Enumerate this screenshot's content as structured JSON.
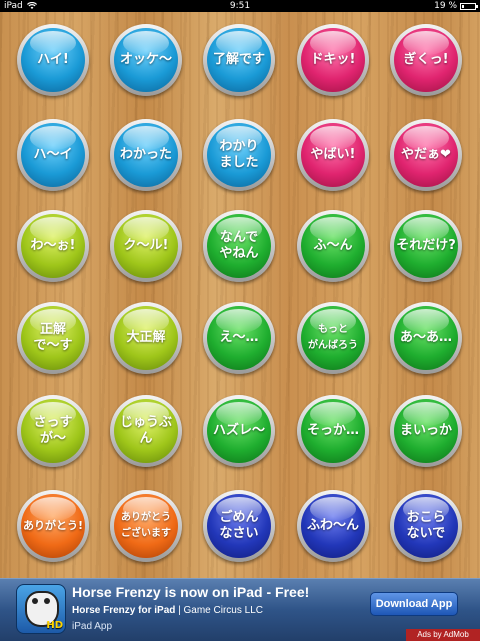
{
  "status_bar": {
    "device": "iPad",
    "time": "9:51",
    "battery": "19 %",
    "battery_level": 0.19
  },
  "colors": {
    "blue": "#1a9ad6",
    "pink": "#e0246f",
    "yellowgreen": "#9fc61a",
    "green": "#1fae2f",
    "orange": "#f06a16",
    "navy": "#2237b9"
  },
  "rows": [
    [
      {
        "label": "ハイ!",
        "color": "blue"
      },
      {
        "label": "オッケ〜",
        "color": "blue"
      },
      {
        "label": "了解です",
        "color": "blue"
      },
      {
        "label": "ドキッ!",
        "color": "pink"
      },
      {
        "label": "ぎくっ!",
        "color": "pink"
      }
    ],
    [
      {
        "label": "ハ〜イ",
        "color": "blue"
      },
      {
        "label": "わかった",
        "color": "blue"
      },
      {
        "label": "わかり\nました",
        "color": "blue"
      },
      {
        "label": "やばい!",
        "color": "pink"
      },
      {
        "label": "やだぁ❤",
        "color": "pink"
      }
    ],
    [
      {
        "label": "わ〜ぉ!",
        "color": "yellowgreen"
      },
      {
        "label": "ク〜ル!",
        "color": "yellowgreen"
      },
      {
        "label": "なんで\nやねん",
        "color": "green"
      },
      {
        "label": "ふ〜ん",
        "color": "green"
      },
      {
        "label": "それだけ?",
        "color": "green"
      }
    ],
    [
      {
        "label": "正解\nで〜す",
        "color": "yellowgreen"
      },
      {
        "label": "大正解",
        "color": "yellowgreen"
      },
      {
        "label": "え〜…",
        "color": "green"
      },
      {
        "label": "もっと\nがんばろう",
        "color": "green"
      },
      {
        "label": "あ〜あ…",
        "color": "green"
      }
    ],
    [
      {
        "label": "さっすが〜",
        "color": "yellowgreen"
      },
      {
        "label": "じゅうぶん",
        "color": "yellowgreen"
      },
      {
        "label": "ハズレ〜",
        "color": "green"
      },
      {
        "label": "そっか…",
        "color": "green"
      },
      {
        "label": "まいっか",
        "color": "green"
      }
    ],
    [
      {
        "label": "ありがとう!",
        "color": "orange"
      },
      {
        "label": "ありがとう\nございます",
        "color": "orange"
      },
      {
        "label": "ごめん\nなさい",
        "color": "navy"
      },
      {
        "label": "ふわ〜ん",
        "color": "navy"
      },
      {
        "label": "おこら\nないで",
        "color": "navy"
      }
    ]
  ],
  "ad": {
    "title": "Horse Frenzy is now on iPad - Free!",
    "app_name": "Horse Frenzy for iPad",
    "publisher": " | Game Circus LLC",
    "category": "iPad App",
    "button": "Download App",
    "icon_badge": "HD",
    "attribution": "Ads by AdMob"
  }
}
